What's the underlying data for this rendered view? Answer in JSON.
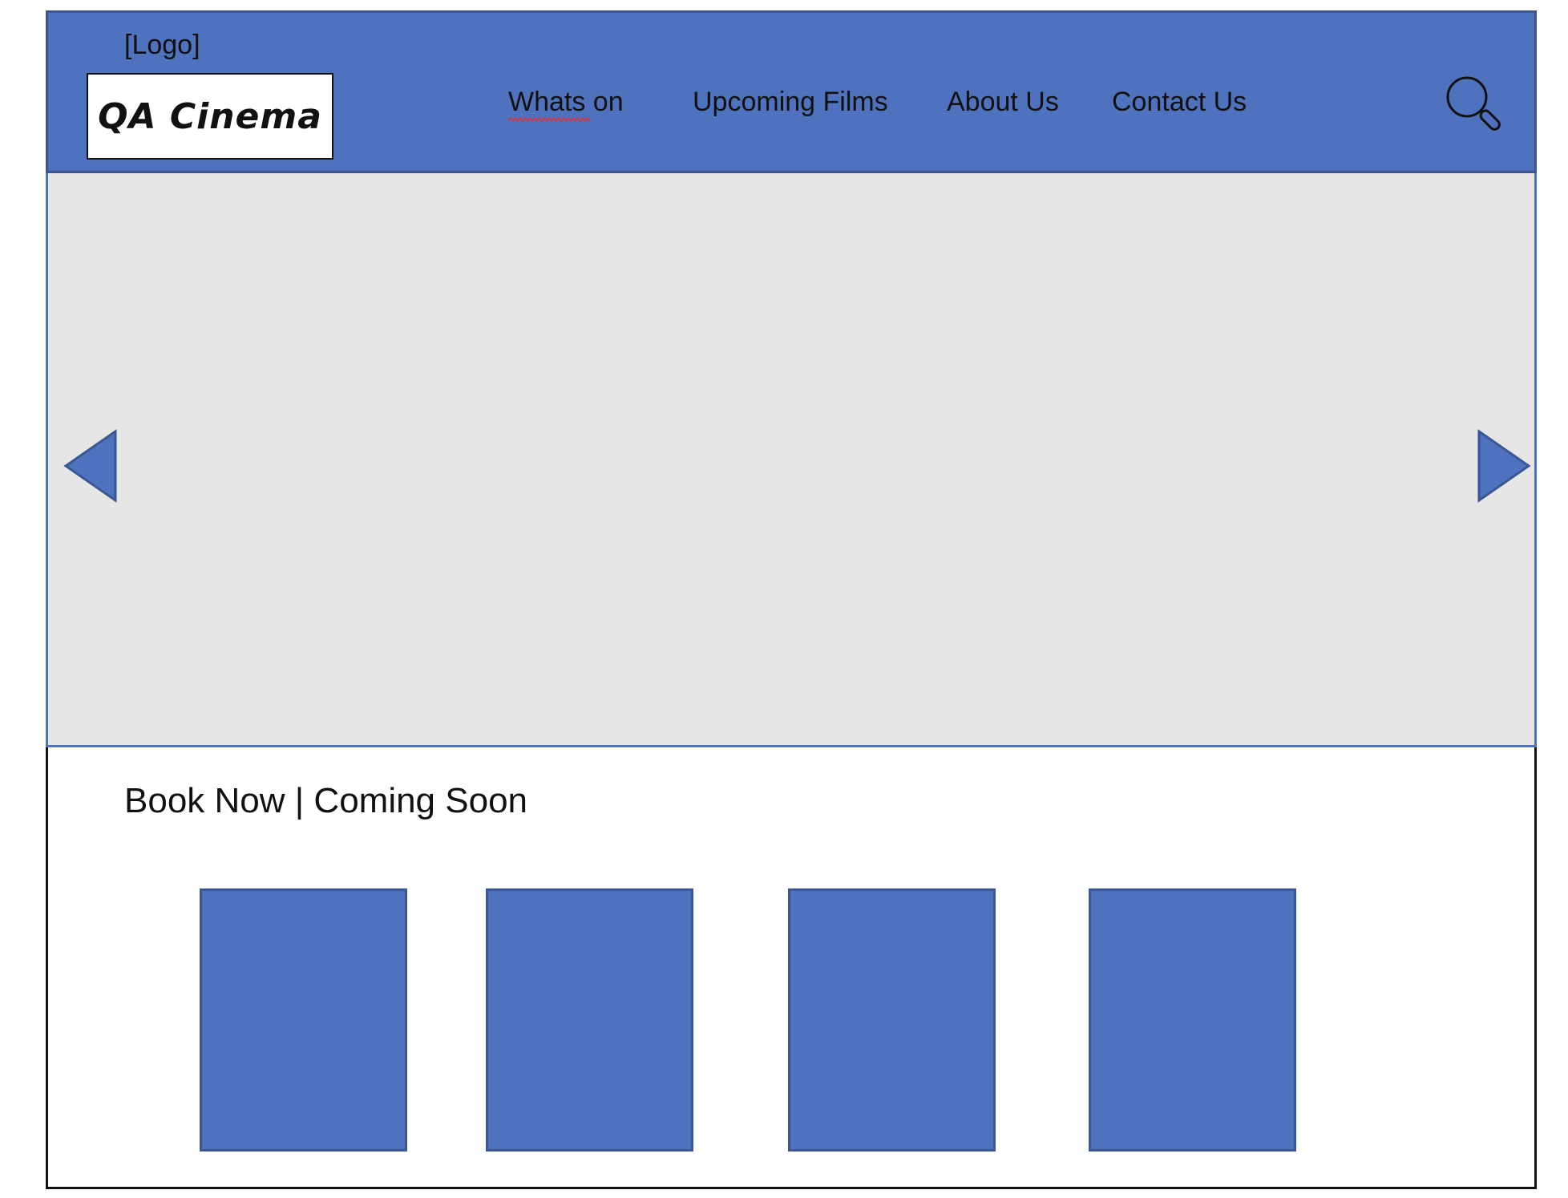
{
  "header": {
    "logo_caption": "[Logo]",
    "logo_text": "QA Cinema",
    "nav": [
      {
        "label": "Whats on"
      },
      {
        "label": "Upcoming Films"
      },
      {
        "label": "About Us"
      },
      {
        "label": "Contact Us"
      }
    ],
    "search_icon": "search-icon"
  },
  "carousel": {
    "prev_icon": "triangle-left",
    "next_icon": "triangle-right"
  },
  "section": {
    "title": "Book Now | Coming Soon",
    "cards": [
      {},
      {},
      {},
      {}
    ]
  },
  "colors": {
    "primary": "#4f72be",
    "primary_border": "#3a5794",
    "carousel_bg": "#e6e6e6",
    "text": "#111111",
    "spellcheck": "#e03030"
  }
}
